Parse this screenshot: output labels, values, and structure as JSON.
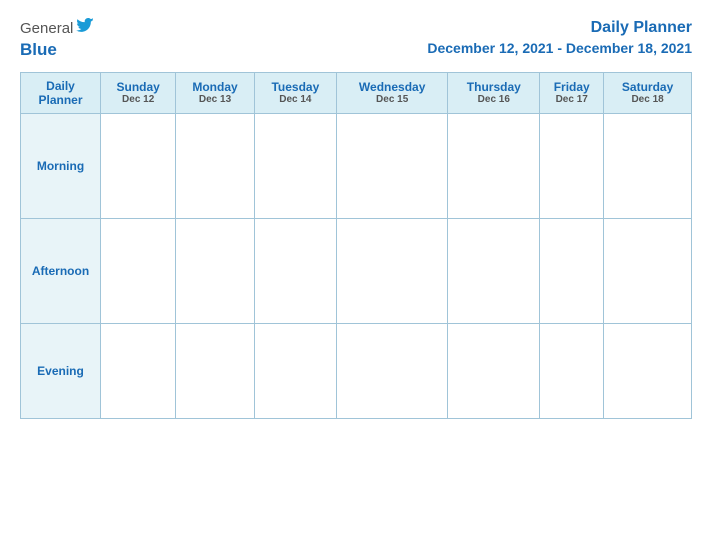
{
  "header": {
    "logo": {
      "general": "General",
      "blue": "Blue",
      "bird_unicode": "🐦"
    },
    "title": "Daily Planner",
    "date_range": "December 12, 2021 - December 18, 2021"
  },
  "calendar": {
    "col_header": {
      "label_day": "Daily",
      "label_planner": "Planner"
    },
    "days": [
      {
        "name": "Sunday",
        "date": "Dec 12"
      },
      {
        "name": "Monday",
        "date": "Dec 13"
      },
      {
        "name": "Tuesday",
        "date": "Dec 14"
      },
      {
        "name": "Wednesday",
        "date": "Dec 15"
      },
      {
        "name": "Thursday",
        "date": "Dec 16"
      },
      {
        "name": "Friday",
        "date": "Dec 17"
      },
      {
        "name": "Saturday",
        "date": "Dec 18"
      }
    ],
    "time_slots": [
      {
        "label": "Morning"
      },
      {
        "label": "Afternoon"
      },
      {
        "label": "Evening"
      }
    ]
  }
}
